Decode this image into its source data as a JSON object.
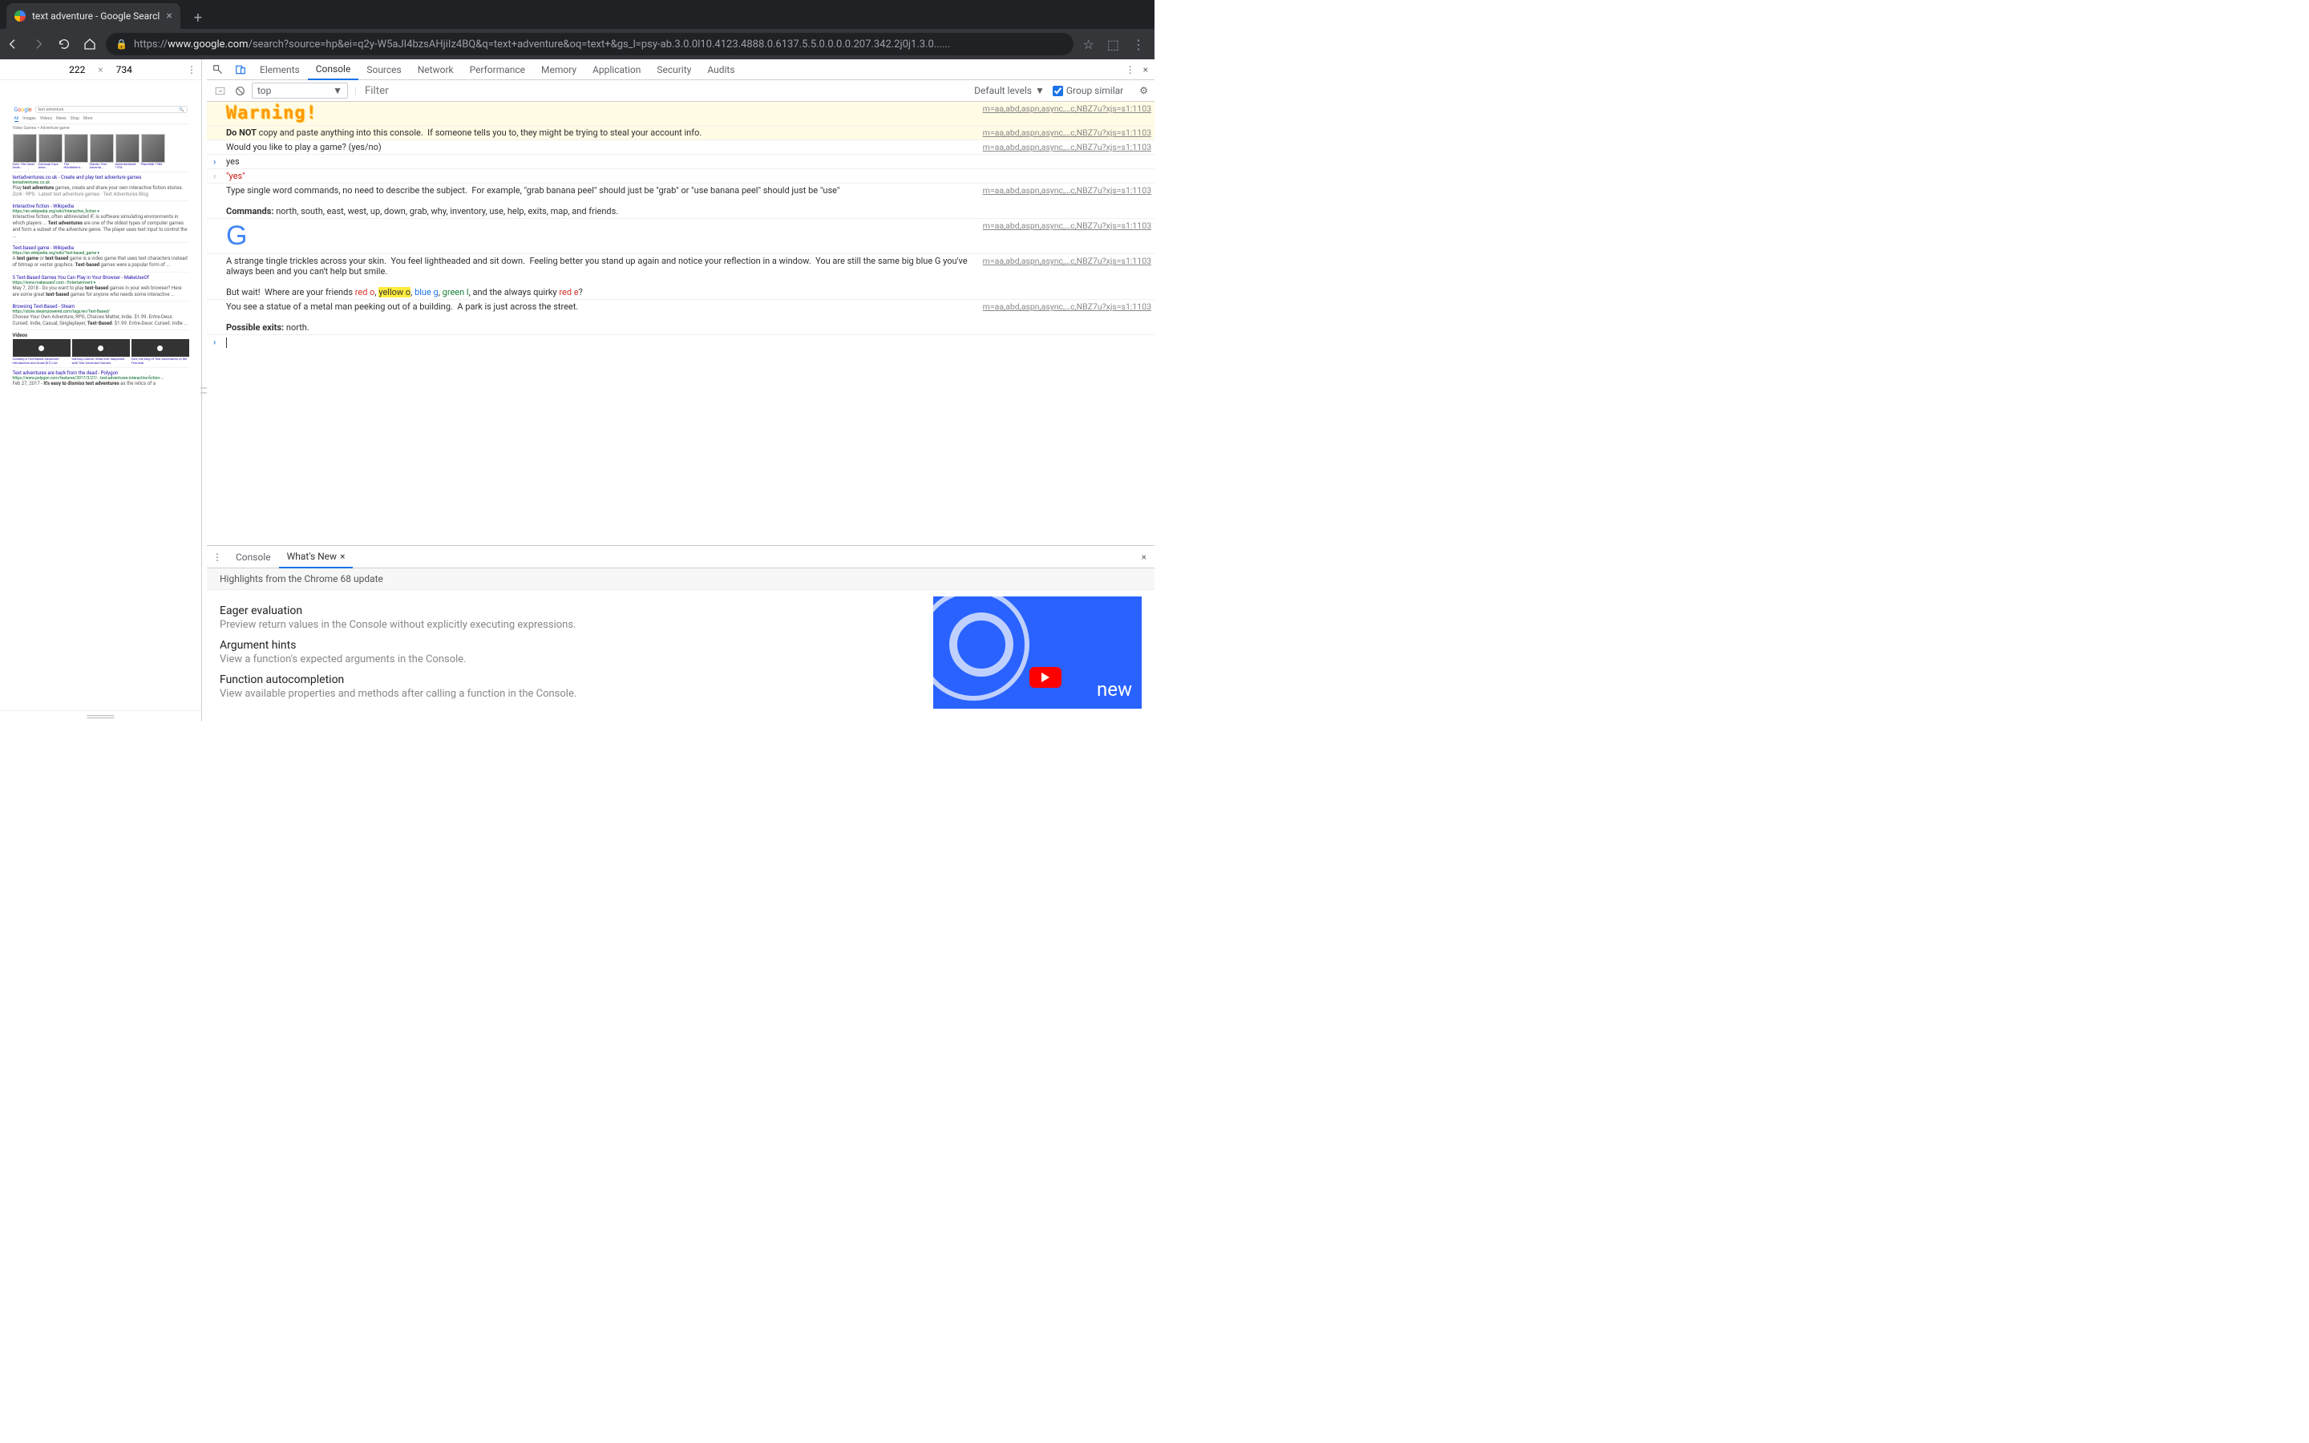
{
  "browser": {
    "tab_title": "text adventure - Google Searcl",
    "url_scheme": "https://",
    "url_host": "www.google.com",
    "url_path": "/search?source=hp&ei=q2y-W5aJI4bzsAHjiIz4BQ&q=text+adventure&oq=text+&gs_l=psy-ab.3.0.0l10.4123.4888.0.6137.5.5.0.0.0.0.207.342.2j0j1.3.0......"
  },
  "device_toolbar": {
    "width": "222",
    "height": "734"
  },
  "devtools": {
    "tabs": [
      "Elements",
      "Console",
      "Sources",
      "Network",
      "Performance",
      "Memory",
      "Application",
      "Security",
      "Audits"
    ],
    "active_tab": "Console",
    "console_toolbar": {
      "context": "top",
      "filter_placeholder": "Filter",
      "levels": "Default levels",
      "group_similar": "Group similar"
    },
    "source_link": "m=aa,abd,aspn,async,…c,NBZ7u?xjs=s1:1103",
    "console": {
      "warning_word": "Warning!",
      "warning_line": "Do NOT copy and paste anything into this console.  If someone tells you to, they might be trying to steal your account info.",
      "play_prompt": "Would you like to play a game? (yes/no)",
      "user_input": "yes",
      "echo": "\"yes\"",
      "instructions": "Type single word commands, no need to describe the subject.  For example, \"grab banana peel\" should just be \"grab\" or \"use banana peel\" should just be \"use\"",
      "commands_label": "Commands:",
      "commands": " north, south, east, west, up, down, grab, why, inventory, use, help, exits, map, and friends.",
      "story1": "A strange tingle trickles across your skin.  You feel lightheaded and sit down.  Feeling better you stand up again and notice your reflection in a window.  You are still the same big blue G you've always been and you can't help but smile.",
      "story2_pre": "But wait!  Where are your friends ",
      "story2_red": "red o",
      "story2_yellow": "yellow o",
      "story2_blue": "blue g",
      "story2_green": "green l",
      "story2_mid": ", and the always quirky ",
      "story2_rede": "red e",
      "story2_q": "?",
      "story3": "You see a statue of a metal man peeking out of a building.  A park is just across the street.",
      "exits_label": "Possible exits:",
      "exits": " north."
    }
  },
  "drawer": {
    "tabs": [
      "Console",
      "What's New"
    ],
    "highlights": "Highlights from the Chrome 68 update",
    "features": [
      {
        "title": "Eager evaluation",
        "desc": "Preview return values in the Console without explicitly executing expressions."
      },
      {
        "title": "Argument hints",
        "desc": "View a function's expected arguments in the Console."
      },
      {
        "title": "Function autocompletion",
        "desc": "View available properties and methods after calling a function in the Console."
      }
    ],
    "promo_text": "new"
  },
  "mini": {
    "query": "text adventure",
    "tabs": [
      "All",
      "Images",
      "Videos",
      "News",
      "Shop",
      "More"
    ],
    "crumb": "Video Games > Adventure game",
    "cards": [
      "Zork: The Great Unde…",
      "Colossal Cave Adve…",
      "The Hitchhiker's…",
      "Classic Text Adventu…",
      "Adventureland 1978",
      "Planetfall 1983"
    ],
    "videos_heading": "Videos",
    "results": [
      {
        "title": "textadventures.co.uk - Create and play text adventure games",
        "url": "textadventures.co.uk",
        "snip_html": "Play <b>text adventure</b> games, create and share your own interactive fiction stories.",
        "sub": "Zork · RPG · Latest text adventure games · Text Adventures Blog"
      },
      {
        "title": "Interactive fiction - Wikipedia",
        "url": "https://en.wikipedia.org/wiki/Interactive_fiction ▾",
        "snip_html": "Interactive fiction, often abbreviated IF, is software simulating environments in which players ... <b>Text adventures</b> are one of the oldest types of computer games and form a subset of the adventure genre. The player uses text input to control the ..."
      },
      {
        "title": "Text-based game - Wikipedia",
        "url": "https://en.wikipedia.org/wiki/Text-based_game ▾",
        "snip_html": "A <b>text game</b> or <b>text-based</b> game is a video game that uses text characters instead of bitmap or vector graphics. <b>Text-based</b> games were a popular form of ..."
      },
      {
        "title": "5 Text-Based Games You Can Play in Your Browser - MakeUseOf",
        "url": "https://www.makeuseof.com › Entertainment ▾",
        "snip_html": "May 7, 2018 - Do you want to play <b>text-based</b> games in your web browser? Here are some great <b>text-based</b> games for anyone who needs some interactive ..."
      },
      {
        "title": "Browsing Text-Based - Steam",
        "url": "https://store.steampowered.com/tags/en/Text-Based/",
        "snip_html": "Choose Your Own Adventure, RPG, Choices Matter, Indie. $1.99. Entre-Deux: Cursed. Indie, Casual, Singleplayer, <b>Text-Based</b>. $1.99. Entre-Deux: Cursed. Indie ..."
      },
      {
        "title": "Text adventures are back from the dead - Polygon",
        "url": "https://www.polygon.com/features/2017/3/27/...text-adventures-interactive-fiction-...",
        "snip_html": "Feb 27, 2017 - <b>It's easy to dismiss text adventures</b> as the relics of a"
      }
    ],
    "video_items": [
      {
        "t": "Creating a Text Based Adventure - Introduction and Goals [01] Live"
      },
      {
        "t": "Gaming Culture: What ever happened with Text Adventure Games"
      },
      {
        "t": "Zork, the king of Text Adventures, in the Terminal"
      }
    ]
  }
}
